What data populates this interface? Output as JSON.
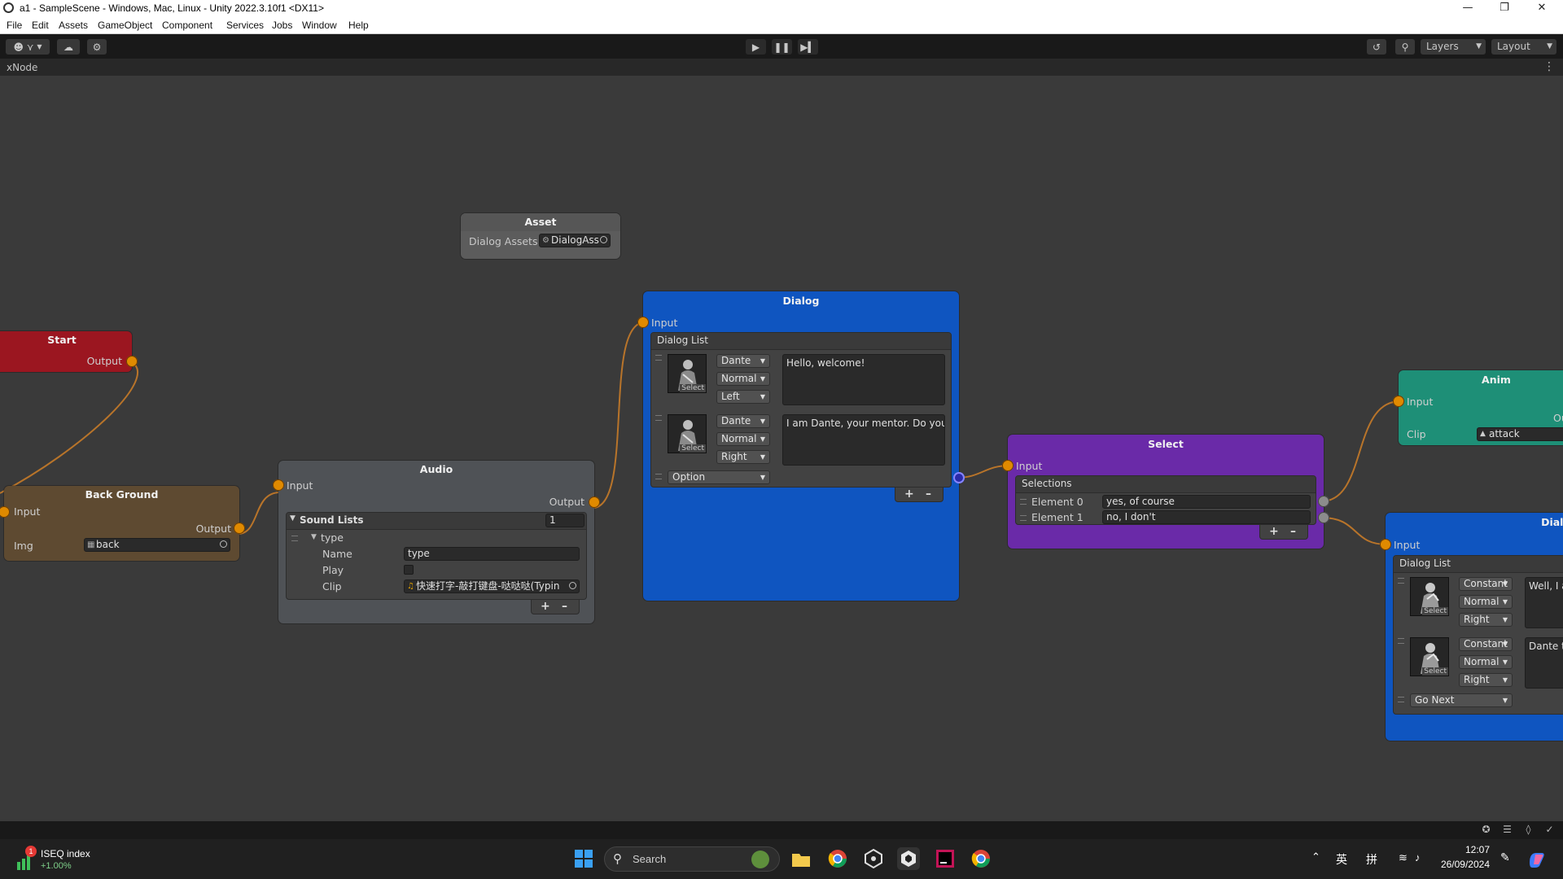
{
  "window": {
    "title": "a1 - SampleScene - Windows, Mac, Linux - Unity 2022.3.10f1 <DX11>",
    "minimize_icon": "minimize-icon",
    "maximize_icon": "maximize-icon",
    "close_icon": "close-icon"
  },
  "menu": [
    "File",
    "Edit",
    "Assets",
    "GameObject",
    "Component",
    "Services",
    "Jobs",
    "Window",
    "Help"
  ],
  "toolbar": {
    "layers_label": "Layers",
    "layout_label": "Layout",
    "play_icon": "play-icon",
    "pause_icon": "pause-icon",
    "step_icon": "step-icon"
  },
  "tab": {
    "title": "xNode"
  },
  "nodes": {
    "asset": {
      "title": "Asset",
      "dialog_assets_label": "Dialog Assets",
      "dialog_assets_value": "DialogAss",
      "color": "#5c5c5c"
    },
    "start": {
      "title": "Start",
      "output_label": "Output",
      "color": "#9b1620"
    },
    "background": {
      "title": "Back Ground",
      "input_label": "Input",
      "output_label": "Output",
      "img_label": "Img",
      "img_value": "back",
      "color": "#5e4a31"
    },
    "audio": {
      "title": "Audio",
      "input_label": "Input",
      "output_label": "Output",
      "sound_lists_label": "Sound Lists",
      "sound_lists_count": "1",
      "element_label": "type",
      "name_label": "Name",
      "name_value": "type",
      "play_label": "Play",
      "clip_label": "Clip",
      "clip_value": "快速打字-敲打键盘-哒哒哒(Typin",
      "color": "#4f5256"
    },
    "dialog1": {
      "title": "Dialog",
      "input_label": "Input",
      "dialog_list_label": "Dialog List",
      "select_label": "Select",
      "entries": [
        {
          "character": "Dante",
          "mood": "Normal",
          "side": "Left",
          "text": "Hello, welcome!"
        },
        {
          "character": "Dante",
          "mood": "Normal",
          "side": "Right",
          "text": "I am Dante, your mentor. Do you wa"
        }
      ],
      "option_value": "Option",
      "color": "#0f55c0"
    },
    "select": {
      "title": "Select",
      "input_label": "Input",
      "selections_label": "Selections",
      "elements": [
        {
          "label": "Element 0",
          "value": "yes, of course"
        },
        {
          "label": "Element 1",
          "value": "no, I don't"
        }
      ],
      "color": "#6a2aa8"
    },
    "anim": {
      "title": "Anim",
      "input_label": "Input",
      "output_label": "Ou",
      "clip_label": "Clip",
      "clip_value": "attack",
      "color": "#1e8f77"
    },
    "dialog2": {
      "title": "Dialog",
      "input_label": "Input",
      "dialog_list_label": "Dialog List",
      "select_label": "Select",
      "entries": [
        {
          "character": "Constant",
          "mood": "Normal",
          "side": "Right",
          "text": "Well, I a"
        },
        {
          "character": "Constant",
          "mood": "Normal",
          "side": "Right",
          "text": "Dante te"
        }
      ],
      "option_value": "Go Next",
      "color": "#0f55c0"
    }
  },
  "taskbar": {
    "widget_title": "ISEQ index",
    "widget_value": "+1.00%",
    "widget_badge": "1",
    "search_placeholder": "Search",
    "ime_lang": "英",
    "ime_mode": "拼",
    "time": "12:07",
    "date": "26/09/2024"
  }
}
